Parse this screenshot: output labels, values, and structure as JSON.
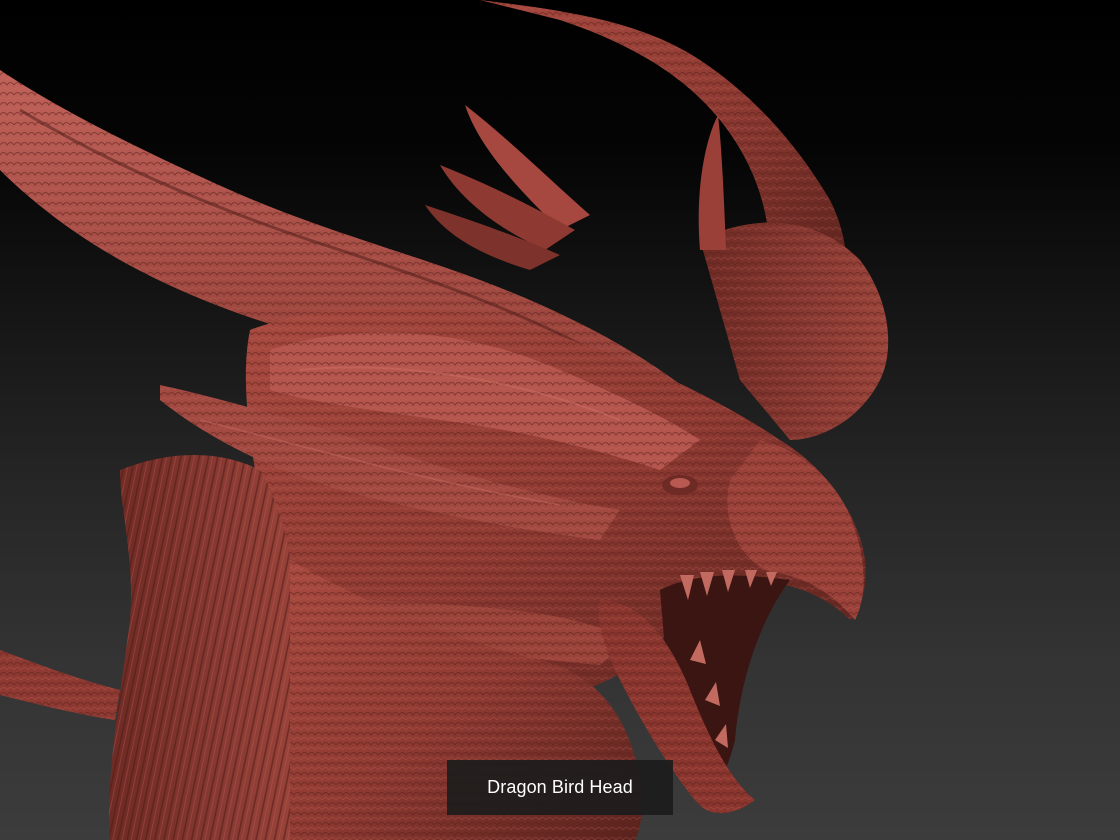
{
  "viewport": {
    "background_top": "#000000",
    "background_bottom": "#3c3c3c",
    "model_color": "#8e3a32",
    "model_highlight": "#c0625a",
    "model_shadow": "#3a1512"
  },
  "model": {
    "icon": "dragon-head-sculpt"
  },
  "caption": {
    "title": "Dragon Bird Head"
  }
}
